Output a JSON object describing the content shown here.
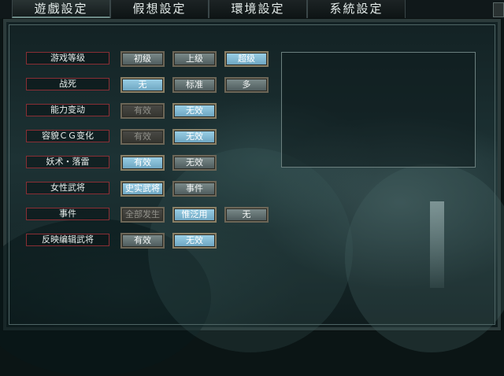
{
  "tabs": [
    {
      "label": "遊戲設定",
      "active": true
    },
    {
      "label": "假想設定",
      "active": false
    },
    {
      "label": "環境設定",
      "active": false
    },
    {
      "label": "系統設定",
      "active": false
    }
  ],
  "settings": [
    {
      "label": "游戏等级",
      "options": [
        {
          "text": "初级",
          "state": "normal"
        },
        {
          "text": "上级",
          "state": "normal"
        },
        {
          "text": "超级",
          "state": "selected"
        }
      ]
    },
    {
      "label": "战死",
      "options": [
        {
          "text": "无",
          "state": "selected"
        },
        {
          "text": "标准",
          "state": "normal"
        },
        {
          "text": "多",
          "state": "normal"
        }
      ]
    },
    {
      "label": "能力变动",
      "options": [
        {
          "text": "有效",
          "state": "disabled"
        },
        {
          "text": "无效",
          "state": "selected"
        }
      ]
    },
    {
      "label": "容貌ＣＧ变化",
      "options": [
        {
          "text": "有效",
          "state": "disabled"
        },
        {
          "text": "无效",
          "state": "selected"
        }
      ]
    },
    {
      "label": "妖术・落雷",
      "options": [
        {
          "text": "有效",
          "state": "selected"
        },
        {
          "text": "无效",
          "state": "normal"
        }
      ]
    },
    {
      "label": "女性武将",
      "options": [
        {
          "text": "史实武将",
          "state": "selected"
        },
        {
          "text": "事件",
          "state": "normal"
        }
      ]
    },
    {
      "label": "事件",
      "options": [
        {
          "text": "全部发生",
          "state": "disabled"
        },
        {
          "text": "惟泛用",
          "state": "selected"
        },
        {
          "text": "无",
          "state": "normal"
        }
      ]
    },
    {
      "label": "反映编辑武将",
      "options": [
        {
          "text": "有效",
          "state": "normal"
        },
        {
          "text": "无效",
          "state": "selected"
        }
      ]
    }
  ],
  "colors": {
    "selected": "#8cc4dc",
    "label_border": "#8a2e34",
    "background": "#1b2e30"
  }
}
